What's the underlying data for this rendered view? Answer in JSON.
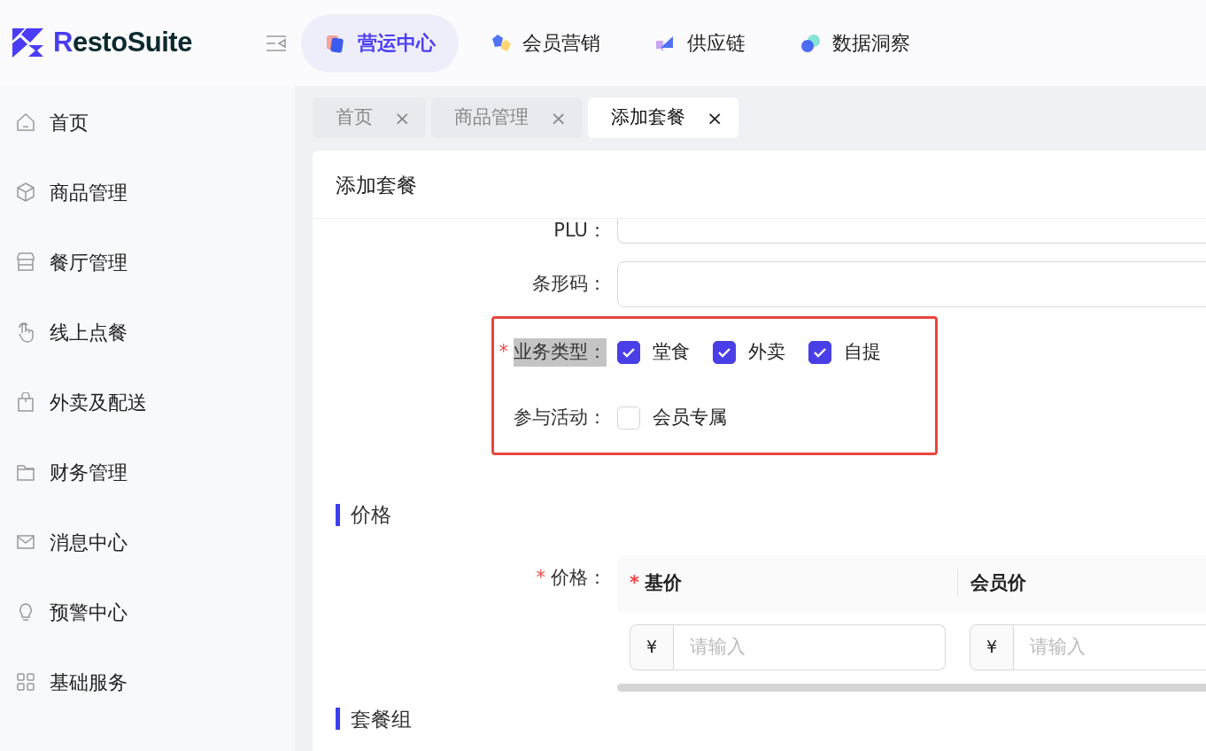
{
  "brand": {
    "name_accent": "R",
    "name_rest": "estoSuite"
  },
  "top_nav": [
    {
      "label": "营运中心",
      "selected": true
    },
    {
      "label": "会员营销",
      "selected": false
    },
    {
      "label": "供应链",
      "selected": false
    },
    {
      "label": "数据洞察",
      "selected": false
    }
  ],
  "sidebar": {
    "items": [
      {
        "label": "首页"
      },
      {
        "label": "商品管理"
      },
      {
        "label": "餐厅管理"
      },
      {
        "label": "线上点餐"
      },
      {
        "label": "外卖及配送"
      },
      {
        "label": "财务管理"
      },
      {
        "label": "消息中心"
      },
      {
        "label": "预警中心"
      },
      {
        "label": "基础服务"
      }
    ]
  },
  "tabs": [
    {
      "label": "首页",
      "selected": false,
      "close": "×"
    },
    {
      "label": "商品管理",
      "selected": false,
      "close": "×"
    },
    {
      "label": "添加套餐",
      "selected": true,
      "close": "×"
    }
  ],
  "page": {
    "title": "添加套餐"
  },
  "fields": [
    {
      "label": "PLU："
    },
    {
      "label": "条形码："
    }
  ],
  "highlight_group": {
    "rows": [
      {
        "label": "业务类型",
        "colon": "：",
        "required_mark": "*",
        "highlighted": true,
        "options": [
          {
            "label": "堂食",
            "checked": true
          },
          {
            "label": "外卖",
            "checked": true
          },
          {
            "label": "自提",
            "checked": true
          }
        ]
      },
      {
        "label": "参与活动",
        "colon": "：",
        "highlighted": false,
        "options": [
          {
            "label": "会员专属",
            "checked": false
          }
        ]
      }
    ]
  },
  "price_section": {
    "title": "价格",
    "label": "价格：",
    "required_mark": "*",
    "columns": [
      {
        "label": "基价",
        "required_mark": "*"
      },
      {
        "label": "会员价"
      }
    ],
    "inputs": [
      {
        "prefix": "¥",
        "placeholder": "请输入"
      },
      {
        "prefix": "¥",
        "placeholder": "请输入"
      }
    ]
  },
  "combo_section": {
    "title": "套餐组"
  }
}
